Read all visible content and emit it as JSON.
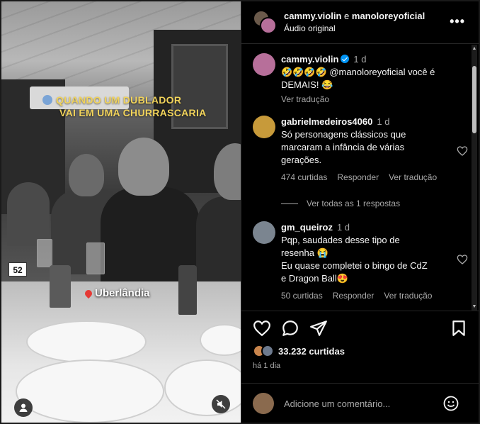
{
  "video": {
    "caption_line1": "QUANDO UM DUBLADOR",
    "caption_line2": "VAI EM UMA CHURRASCARIA",
    "location": "Uberlândia",
    "table_number": "52"
  },
  "header": {
    "user1": "cammy.violin",
    "connector": "e",
    "user2": "manoloreyoficial",
    "audio": "Áudio original",
    "more": "•••"
  },
  "comments": [
    {
      "user": "cammy.violin",
      "time": "1 d",
      "text": "🤣🤣🤣🤣 @manoloreyoficial você é DEMAIS! 😂",
      "translate": "Ver tradução",
      "avatar_color": "#b76f9a"
    },
    {
      "user": "gabrielmedeiros4060",
      "time": "1 d",
      "text": "Só personagens clássicos que marcaram a infância de várias gerações.",
      "likes": "474 curtidas",
      "reply": "Responder",
      "translate": "Ver tradução",
      "avatar_color": "#c79a3a"
    },
    {
      "user": "gm_queiroz",
      "time": "1 d",
      "text_line1": "Pqp, saudades desse tipo de resenha 😭",
      "text_line2": "Eu quase completei o bingo de CdZ e Dragon Ball😍",
      "likes": "50 curtidas",
      "reply": "Responder",
      "translate": "Ver tradução",
      "avatar_color": "#7b8590"
    }
  ],
  "view_replies": "Ver todas as 1 respostas",
  "post": {
    "likes": "33.232 curtidas",
    "time_ago": "há 1 dia"
  },
  "add_comment": {
    "placeholder": "Adicione um comentário..."
  },
  "colors": {
    "background": "#000000",
    "text": "#f5f5f5",
    "secondary": "#a8a8a8",
    "verified": "#0095f6",
    "caption": "#f1d35b"
  }
}
